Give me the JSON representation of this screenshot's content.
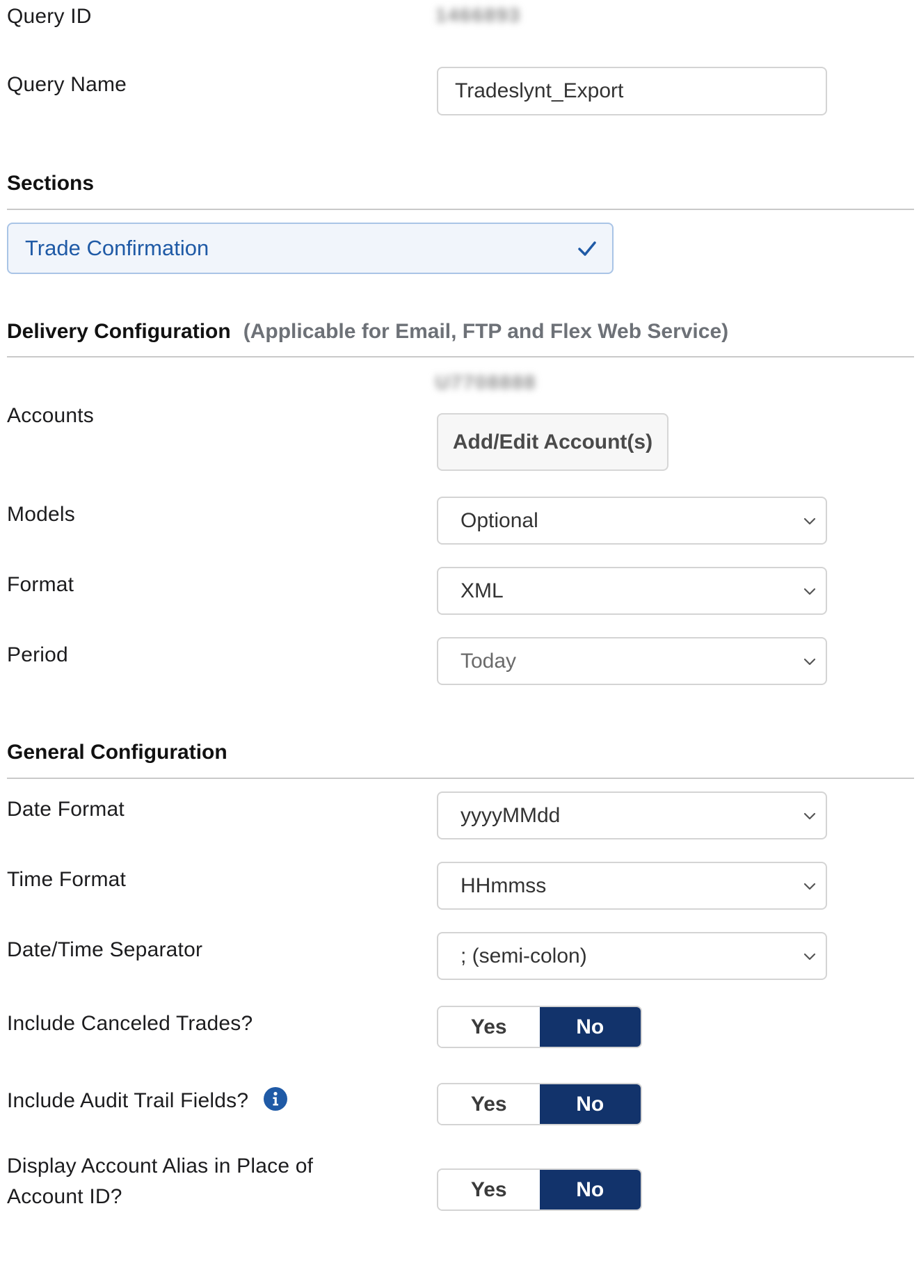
{
  "query": {
    "id_label": "Query ID",
    "id_value": "1466893",
    "name_label": "Query Name",
    "name_value": "Tradeslynt_Export"
  },
  "sections": {
    "heading": "Sections",
    "item_label": "Trade Confirmation"
  },
  "delivery": {
    "heading": "Delivery Configuration",
    "note": "(Applicable for Email, FTP and Flex Web Service)",
    "accounts_label": "Accounts",
    "accounts_value": "U7708888",
    "accounts_button": "Add/Edit Account(s)",
    "models_label": "Models",
    "models_value": "Optional",
    "format_label": "Format",
    "format_value": "XML",
    "period_label": "Period",
    "period_value": "Today"
  },
  "general": {
    "heading": "General Configuration",
    "date_format_label": "Date Format",
    "date_format_value": "yyyyMMdd",
    "time_format_label": "Time Format",
    "time_format_value": "HHmmss",
    "separator_label": "Date/Time Separator",
    "separator_value": "; (semi-colon)",
    "canceled_label": "Include Canceled Trades?",
    "audit_label": "Include Audit Trail Fields?",
    "alias_label_line1": "Display Account Alias in Place of",
    "alias_label_line2": "Account ID?",
    "yes_label": "Yes",
    "no_label": "No"
  },
  "colors": {
    "toggle_selected": "#12336b",
    "chip_text": "#1f5aa6",
    "info_icon": "#1f5aa6"
  },
  "icons": {
    "checkmark": "check-icon",
    "dropdown": "chevron-down-icon",
    "info": "info-icon"
  }
}
